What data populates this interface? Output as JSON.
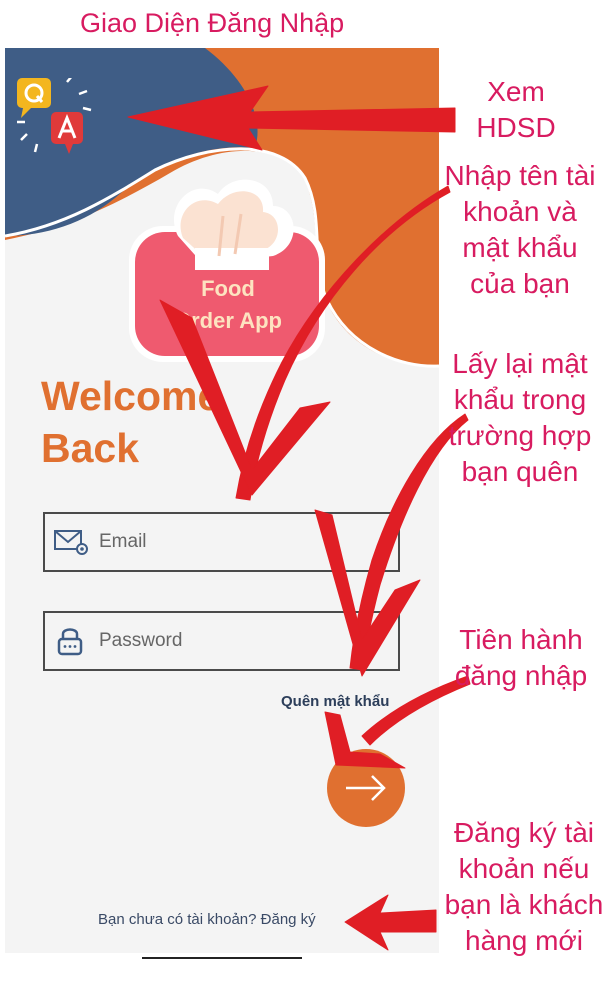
{
  "header": {
    "title": "Giao Diện Đăng Nhập"
  },
  "app": {
    "logo": {
      "line1": "Food",
      "line2": "Order App"
    },
    "welcome": {
      "line1": "Welcome",
      "line2": "Back"
    },
    "email": {
      "placeholder": "Email",
      "value": ""
    },
    "password": {
      "placeholder": "Password",
      "value": ""
    },
    "forgot_label": "Quên mật khẩu",
    "signup_label": "Bạn chưa có tài khoản? Đăng ký"
  },
  "annotations": {
    "guide": "Xem HDSD",
    "credentials": "Nhập tên tài khoản và mật khẩu của bạn",
    "forgot": "Lấy lại mật khẩu trong trường hợp bạn quên",
    "login": "Tiên hành đăng nhập",
    "signup": "Đăng ký tài khoản nếu bạn là khách hàng mới"
  },
  "colors": {
    "accent_orange": "#e07030",
    "header_blue": "#3f5d86",
    "annotation_pink": "#d81b60",
    "arrow_red": "#e01e25",
    "logo_pink": "#ef5a6f"
  },
  "icons": {
    "guide": "qa-help-icon",
    "email": "email-icon",
    "password": "lock-icon",
    "submit": "arrow-right-icon"
  }
}
